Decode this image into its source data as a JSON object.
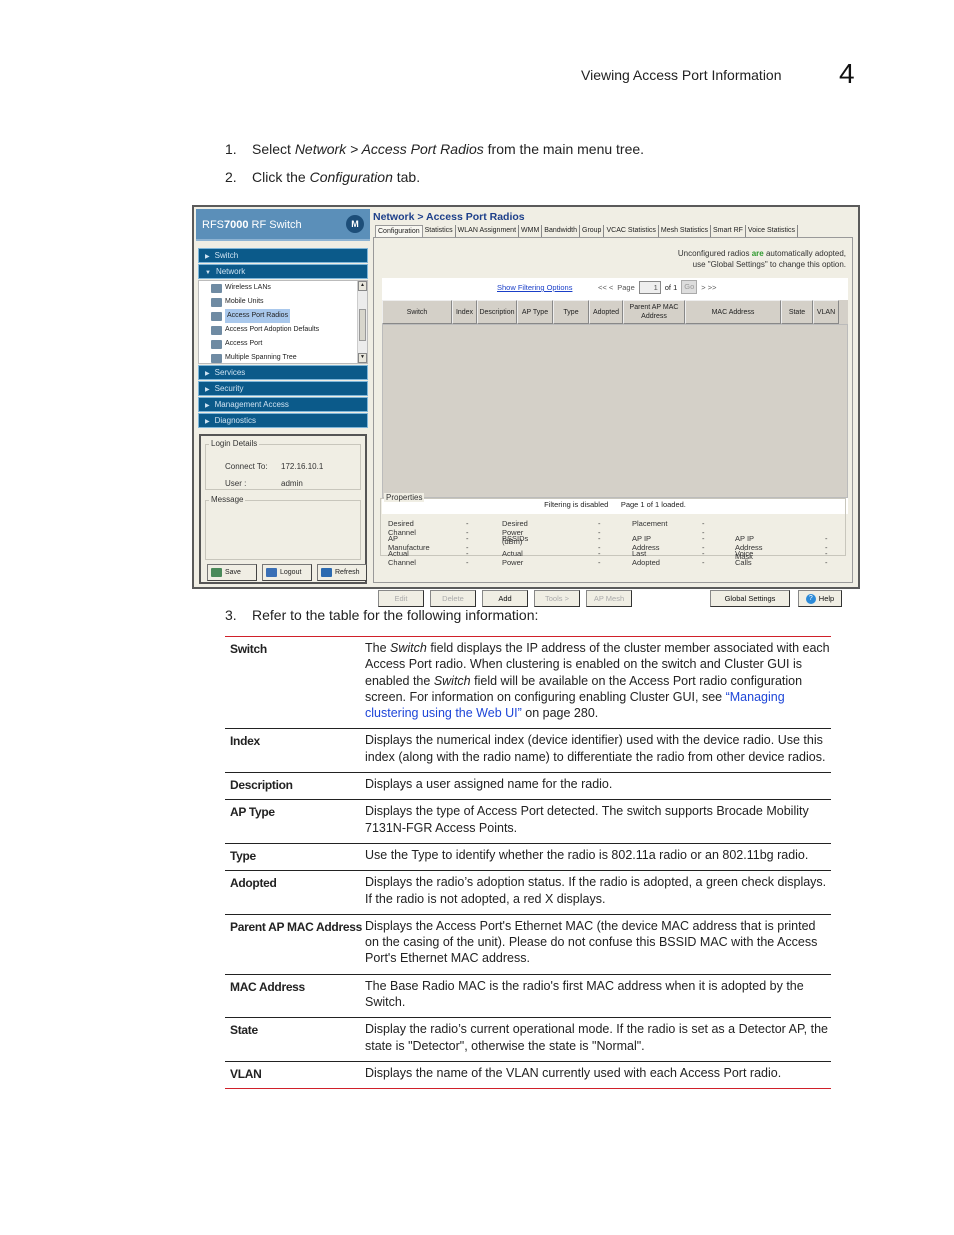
{
  "header": {
    "section_title": "Viewing Access Port Information",
    "chapter_number": "4"
  },
  "steps": [
    {
      "num": "1.",
      "parts": [
        {
          "t": "Select "
        },
        {
          "t": "Network > Access Port Radios",
          "i": true
        },
        {
          "t": " from the main menu tree."
        }
      ]
    },
    {
      "num": "2.",
      "parts": [
        {
          "t": "Click the "
        },
        {
          "t": "Configuration",
          "i": true
        },
        {
          "t": " tab."
        }
      ]
    }
  ],
  "step3": {
    "num": "3.",
    "text": "Refer to the table for the following information:"
  },
  "app": {
    "brand_prefix": "RFS",
    "brand_model": "7000",
    "brand_suffix": " RF Switch",
    "logo": "M",
    "nav_switch": "Switch",
    "nav_network": "Network",
    "tree_items": [
      "Wireless LANs",
      "Mobile Units",
      "Access Port Radios",
      "Access Port Adoption Defaults",
      "Access Port",
      "Multiple Spanning Tree"
    ],
    "tree_selected_index": 2,
    "nav_services": "Services",
    "nav_security": "Security",
    "nav_management": "Management Access",
    "nav_diagnostics": "Diagnostics",
    "login_legend": "Login Details",
    "connect_label": "Connect To:",
    "connect_value": "172.16.10.1",
    "user_label": "User :",
    "user_value": "admin",
    "message_legend": "Message",
    "save": "Save",
    "logout": "Logout",
    "refresh": "Refresh",
    "main_title": "Network > Access Port Radios",
    "tabs": [
      "Configuration",
      "Statistics",
      "WLAN Assignment",
      "WMM",
      "Bandwidth",
      "Group",
      "VCAC Statistics",
      "Mesh Statistics",
      "Smart RF",
      "Voice Statistics"
    ],
    "notice_line1_a": "Unconfigured radios ",
    "notice_line1_green": "are",
    "notice_line1_b": " automatically adopted,",
    "notice_line2": "use \"Global Settings\" to change this option.",
    "show_filter": "Show Filtering Options",
    "pager_prev": "<< <",
    "pager_page": "Page",
    "pager_value": "1",
    "pager_of": "of 1",
    "pager_go": "Go",
    "pager_next": "> >>",
    "columns": [
      "Switch",
      "Index",
      "Description",
      "AP Type",
      "Type",
      "Adopted",
      "Parent AP MAC Address",
      "MAC Address",
      "State",
      "VLAN"
    ],
    "status_filter": "Filtering is disabled",
    "status_page": "Page 1 of 1 loaded.",
    "properties_legend": "Properties",
    "properties": [
      {
        "label": "Desired Channel",
        "value": "--"
      },
      {
        "label": "AP Manufacture",
        "value": "--"
      },
      {
        "label": "Actual Channel",
        "value": "--"
      },
      {
        "label": "Desired Power (dBm)",
        "value": "--"
      },
      {
        "label": "BSSIDs",
        "value": "--"
      },
      {
        "label": "Actual Power",
        "value": "--"
      },
      {
        "label": "Placement",
        "value": "--"
      },
      {
        "label": "AP IP Address",
        "value": "--"
      },
      {
        "label": "Last Adopted",
        "value": "--"
      },
      {
        "label": "AP IP Address Mask",
        "value": "--"
      },
      {
        "label": "Voice Calls",
        "value": "--"
      }
    ],
    "buttons": {
      "edit": "Edit",
      "delete": "Delete",
      "add": "Add",
      "tools": "Tools >",
      "ap_mesh": "AP Mesh",
      "global_settings": "Global Settings",
      "help": "Help"
    }
  },
  "ref_table": [
    {
      "term": "Switch",
      "desc": [
        {
          "t": "The "
        },
        {
          "t": "Switch",
          "i": true
        },
        {
          "t": " field displays the IP address of the cluster member associated with each Access Port radio. When clustering is enabled on the switch and Cluster GUI is enabled the "
        },
        {
          "t": "Switch",
          "i": true
        },
        {
          "t": " field will be available on the Access Port radio configuration screen. For information on configuring enabling Cluster GUI, see "
        },
        {
          "t": "“Managing clustering using the Web UI”",
          "link": true
        },
        {
          "t": " on page 280."
        }
      ]
    },
    {
      "term": "Index",
      "desc": [
        {
          "t": "Displays the numerical index (device identifier) used with the device radio. Use this index (along with the radio name) to differentiate the radio from other device radios."
        }
      ]
    },
    {
      "term": "Description",
      "desc": [
        {
          "t": "Displays a user assigned name for the radio."
        }
      ]
    },
    {
      "term": "AP Type",
      "desc": [
        {
          "t": "Displays the type of Access Port detected. The switch supports Brocade Mobility 7131N-FGR Access Points."
        }
      ]
    },
    {
      "term": "Type",
      "desc": [
        {
          "t": "Use the Type to identify whether the radio is 802.11a radio or an 802.11bg radio."
        }
      ]
    },
    {
      "term": "Adopted",
      "desc": [
        {
          "t": "Displays the radio’s adoption status. If the radio is adopted, a green check displays. If the radio is not adopted, a red X displays."
        }
      ]
    },
    {
      "term": "Parent AP MAC Address",
      "desc": [
        {
          "t": "Displays the Access Port's Ethernet MAC (the device MAC address that is printed on the casing of the unit). Please do not confuse this BSSID MAC with the Access Port's Ethernet MAC address."
        }
      ]
    },
    {
      "term": "MAC Address",
      "desc": [
        {
          "t": "The Base Radio MAC is the radio's first MAC address when it is adopted by the Switch."
        }
      ]
    },
    {
      "term": "State",
      "desc": [
        {
          "t": "Display the radio’s current operational mode. If the radio is set as a Detector AP, the state is \"Detector\", otherwise the state is \"Normal\"."
        }
      ]
    },
    {
      "term": "VLAN",
      "desc": [
        {
          "t": "Displays the name of the VLAN currently used with each Access Port radio."
        }
      ]
    }
  ]
}
